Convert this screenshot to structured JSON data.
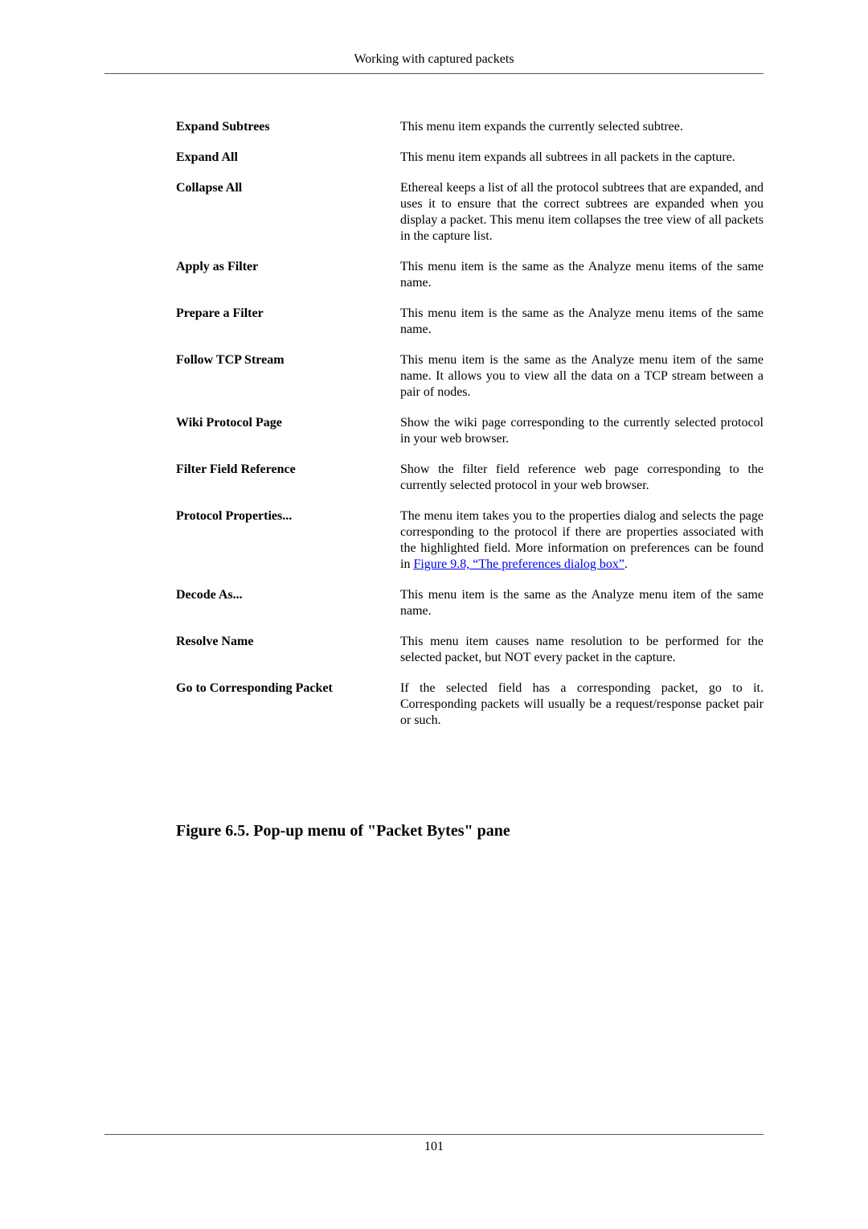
{
  "header": {
    "title": "Working with captured packets"
  },
  "entries": [
    {
      "term": "Expand Subtrees",
      "definition": "This menu item expands the currently selected subtree."
    },
    {
      "term": "Expand All",
      "definition": "This menu item expands all subtrees in all packets in the capture."
    },
    {
      "term": "Collapse All",
      "definition": "Ethereal keeps a list of all the protocol subtrees that are expanded, and uses it to ensure that the correct subtrees are expanded when you display a packet. This menu item collapses the tree view of all packets in the capture list."
    },
    {
      "term": "Apply as Filter",
      "definition": "This menu item is the same as the Analyze menu items of the same name."
    },
    {
      "term": "Prepare a Filter",
      "definition": "This menu item is the same as the Analyze menu items of the same name."
    },
    {
      "term": "Follow TCP Stream",
      "definition": "This menu item is the same as the Analyze menu item of the same name. It allows you to view all the data on a TCP stream between a pair of nodes."
    },
    {
      "term": "Wiki Protocol Page",
      "definition": "Show the wiki page corresponding to the currently selected protocol in your web browser."
    },
    {
      "term": "Filter Field Reference",
      "definition": "Show the filter field reference web page corresponding to the currently selected protocol in your web browser."
    },
    {
      "term": "Protocol Properties...",
      "definition": "The menu item takes you to the properties dialog and selects the page corresponding to the protocol if there are properties associated with the highlighted field. More information on preferences can be found in ",
      "link": "Figure 9.8, “The preferences dialog box”",
      "after": "."
    },
    {
      "term": "Decode As...",
      "definition": "This menu item is the same as the Analyze menu item of the same name."
    },
    {
      "term": "Resolve Name",
      "definition": "This menu item causes name resolution to be performed for the selected packet, but NOT every packet in the capture."
    },
    {
      "term": "Go to Corresponding Packet",
      "definition": "If the selected field has a corresponding packet, go to it. Corresponding packets will usually be a request/response packet pair or such."
    }
  ],
  "figure": {
    "title": "Figure 6.5. Pop-up menu of \"Packet Bytes\" pane"
  },
  "footer": {
    "page_number": "101"
  },
  "colors": {
    "link": "#0000ee",
    "rule": "#555555"
  }
}
